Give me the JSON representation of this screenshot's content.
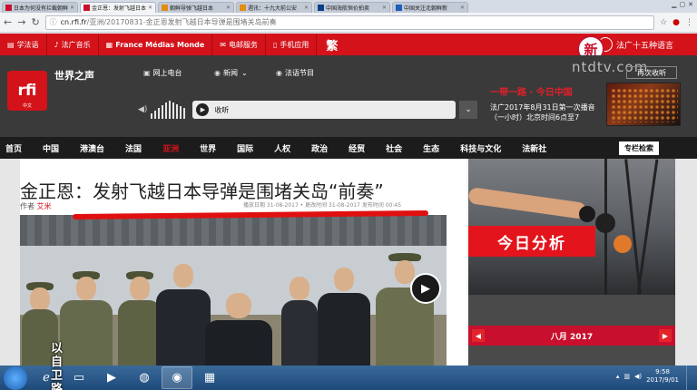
{
  "browser": {
    "tabs": [
      {
        "label": "日本为何没有拦截朝鲜",
        "icon": "ntd-icon",
        "active": false
      },
      {
        "label": "金正恩：发射飞越日本",
        "icon": "rfi-icon",
        "active": true
      },
      {
        "label": "朝鲜导弹飞越日本",
        "icon": "ntd-icon",
        "active": false
      },
      {
        "label": "週讯：十九大前公安",
        "icon": "ntd-icon",
        "active": false
      },
      {
        "label": "中国海航恒价拍卖",
        "icon": "voa-icon",
        "active": false
      },
      {
        "label": "中国关注北朝鲜新",
        "icon": "ntd-icon",
        "active": false
      }
    ],
    "url_domain": "cn.rfi.fr",
    "url_path": "/亚洲/20170831-金正恩发射飞越日本导弹是围堵关岛前奏"
  },
  "topbar": {
    "items": [
      {
        "label": "学法语",
        "icon": "book-icon"
      },
      {
        "label": "法广音乐",
        "icon": "music-icon"
      },
      {
        "label": "France Médias Monde",
        "icon": "fmm-icon"
      },
      {
        "label": "电邮服务",
        "icon": "mail-icon"
      },
      {
        "label": "手机应用",
        "icon": "phone-icon"
      }
    ],
    "traditional": "繁",
    "languages_label": "法广十五种语言",
    "channel_badge": "新"
  },
  "header": {
    "logo_text": "rfi",
    "logo_sub": "中文",
    "site_name": "世界之声",
    "nav": [
      {
        "label": "网上电台",
        "icon": "radio-icon"
      },
      {
        "label": "新闻",
        "icon": "globe-icon"
      },
      {
        "label": "法语节目",
        "icon": "book-icon"
      }
    ],
    "player_label": "收听",
    "watermark": "ntdtv.com",
    "replay_label": "再次收听",
    "promo_title": "一带一路 · 今日中国",
    "promo_text": "法广2017年8月31日第一次播音（一小时）北京时间6点至7"
  },
  "mainnav": {
    "items": [
      "首页",
      "中国",
      "港澳台",
      "法国",
      "亚洲",
      "世界",
      "国际",
      "人权",
      "政治",
      "经贸",
      "社会",
      "生态",
      "科技与文化",
      "法新社"
    ],
    "current": "亚洲",
    "special": "专栏检索"
  },
  "article": {
    "title": "金正恩：发射飞越日本导弹是围堵关岛“前奏”",
    "byline_prefix": "作者",
    "author": "艾米",
    "dates": "播放日期 31-08-2017 • 更改时间 31-08-2017 发布时间 00:45",
    "vertical_note": [
      "以",
      "自",
      "卫",
      "路"
    ]
  },
  "sidebar": {
    "analysis_label": "今日分析",
    "month": "八月 2017"
  },
  "taskbar": {
    "apps": [
      "ie-icon",
      "folder-icon",
      "media-icon",
      "firefox-icon",
      "chrome-icon",
      "image-icon"
    ],
    "time": "9:58",
    "date": "2017/9/01"
  },
  "colors": {
    "rfi_red": "#d3121a",
    "header_dark": "#3a3a3a",
    "nav_black": "#1c1c1c"
  }
}
